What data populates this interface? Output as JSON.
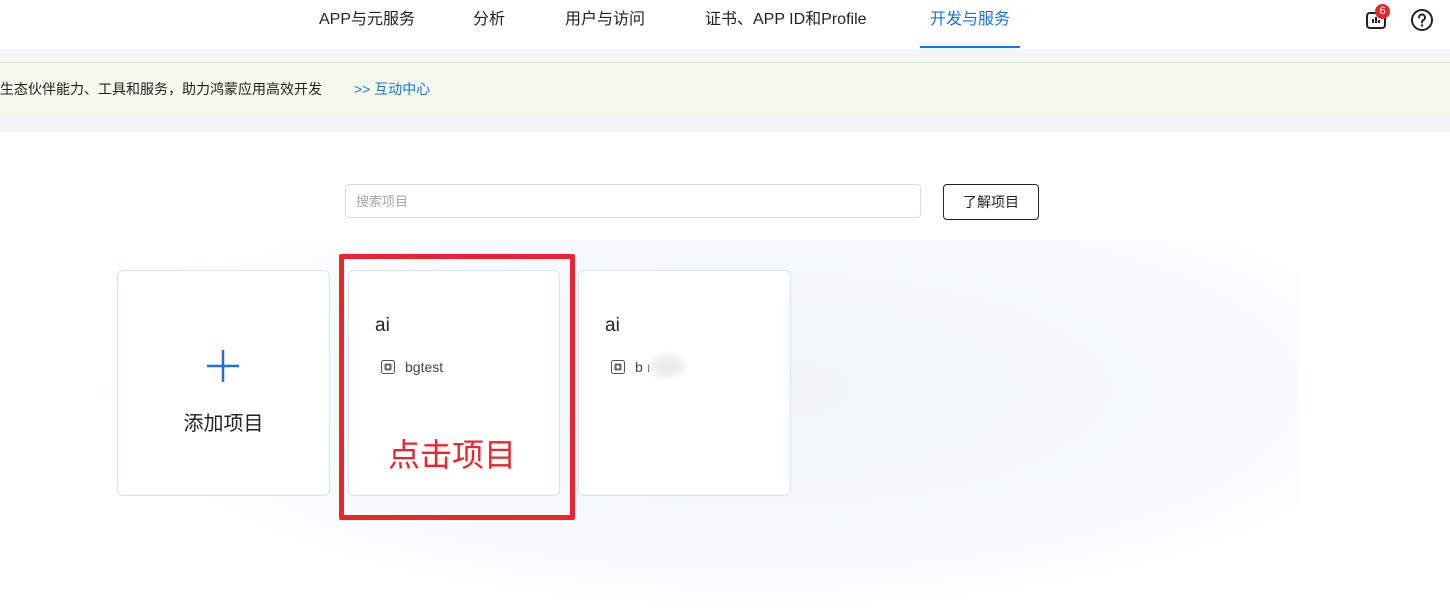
{
  "nav": {
    "tabs": [
      {
        "label": "APP与元服务",
        "active": false
      },
      {
        "label": "分析",
        "active": false
      },
      {
        "label": "用户与访问",
        "active": false
      },
      {
        "label": "证书、APP ID和Profile",
        "active": false
      },
      {
        "label": "开发与服务",
        "active": true
      }
    ],
    "notification_count": "6",
    "notification_icon": "notification-icon",
    "help_icon": "question-circle-icon"
  },
  "banner": {
    "text": "生态伙伴能力、工具和服务，助力鸿蒙应用高效开发",
    "link": ">> 互动中心"
  },
  "search": {
    "placeholder": "搜索项目",
    "value": ""
  },
  "learn_button": "了解项目",
  "add_card": {
    "label": "添加项目",
    "icon": "plus-icon"
  },
  "projects": [
    {
      "name": "ai",
      "app_name": "bgtest",
      "app_icon": "app-icon"
    },
    {
      "name": "ai",
      "app_name": "b        ı",
      "app_icon": "app-icon",
      "redacted": true
    }
  ],
  "annotation": {
    "text": "点击项目",
    "color": "#e8262b"
  },
  "colors": {
    "accent": "#1a73d9",
    "banner_bg": "#f3faec",
    "badge": "#e8262b"
  }
}
